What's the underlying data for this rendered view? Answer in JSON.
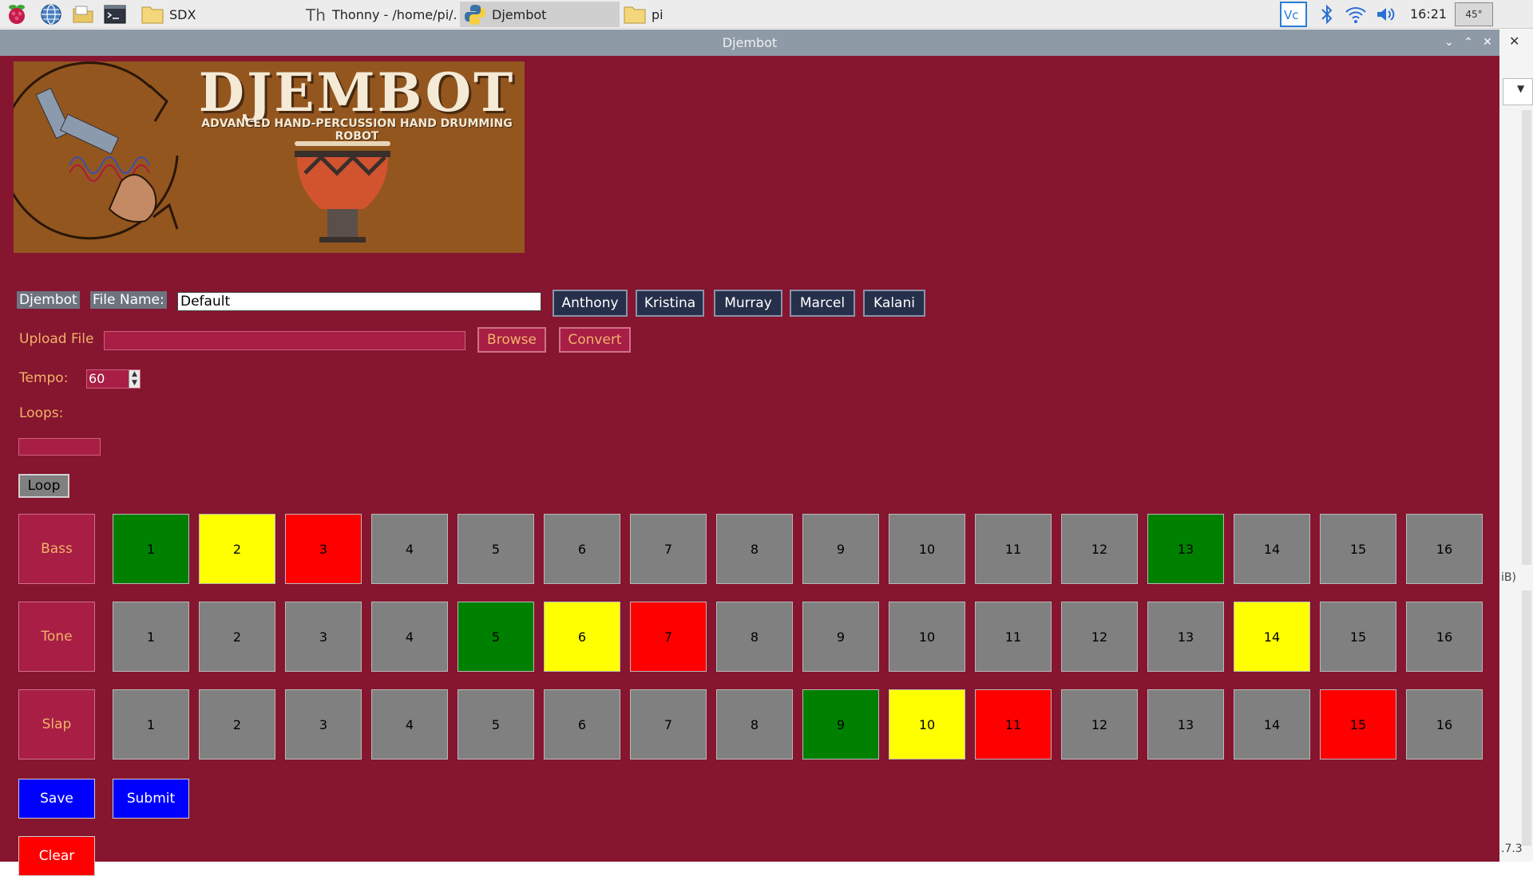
{
  "taskbar": {
    "tasks": [
      {
        "label": "SDX",
        "icon": "folder-icon"
      },
      {
        "label": "Thonny  -  /home/pi/...",
        "icon": "thonny-icon"
      },
      {
        "label": "Djembot",
        "icon": "python-icon"
      },
      {
        "label": "pi",
        "icon": "folder-icon"
      }
    ],
    "clock": "16:21",
    "cpu_temp": "45°"
  },
  "background_window": {
    "fragment_1": "iB)",
    "fragment_2": ".7.3"
  },
  "window": {
    "title": "Djembot"
  },
  "banner": {
    "title": "DJEMBOT",
    "subtitle": "ADVANCED HAND-PERCUSSION HAND DRUMMING ROBOT"
  },
  "controls": {
    "app_label": "Djembot",
    "file_name_label": "File Name:",
    "file_name_value": "Default",
    "users": [
      "Anthony",
      "Kristina",
      "Murray",
      "Marcel",
      "Kalani"
    ],
    "upload_label": "Upload File",
    "upload_value": "",
    "browse_label": "Browse",
    "convert_label": "Convert",
    "tempo_label": "Tempo:",
    "tempo_value": "60",
    "loops_label": "Loops:",
    "loops_value": "",
    "loop_button": "Loop",
    "save_label": "Save",
    "submit_label": "Submit",
    "clear_label": "Clear"
  },
  "colors": {
    "window_bg": "#86152f",
    "off": "#808080",
    "green": "#008000",
    "yellow": "#ffff00",
    "red": "#ff0000",
    "save_submit": "#0000ff",
    "clear": "#ff0000"
  },
  "sequencer": {
    "steps": [
      "1",
      "2",
      "3",
      "4",
      "5",
      "6",
      "7",
      "8",
      "9",
      "10",
      "11",
      "12",
      "13",
      "14",
      "15",
      "16"
    ],
    "rows": [
      {
        "label": "Bass",
        "states": [
          "green",
          "yellow",
          "red",
          "off",
          "off",
          "off",
          "off",
          "off",
          "off",
          "off",
          "off",
          "off",
          "green",
          "off",
          "off",
          "off"
        ]
      },
      {
        "label": "Tone",
        "states": [
          "off",
          "off",
          "off",
          "off",
          "green",
          "yellow",
          "red",
          "off",
          "off",
          "off",
          "off",
          "off",
          "off",
          "yellow",
          "off",
          "off"
        ]
      },
      {
        "label": "Slap",
        "states": [
          "off",
          "off",
          "off",
          "off",
          "off",
          "off",
          "off",
          "off",
          "green",
          "yellow",
          "red",
          "off",
          "off",
          "off",
          "red",
          "off"
        ]
      }
    ]
  }
}
